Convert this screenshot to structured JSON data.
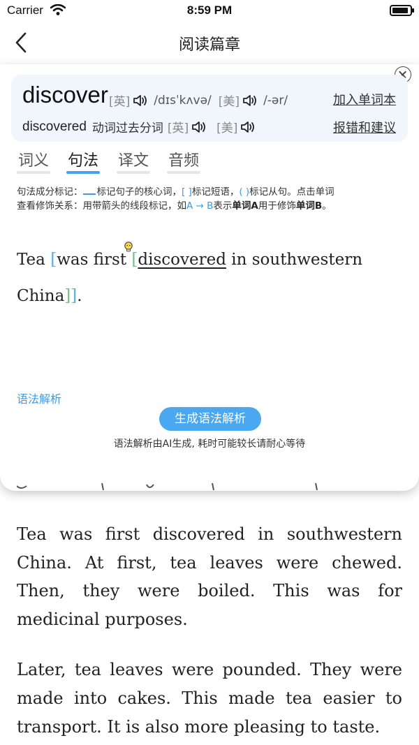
{
  "status_bar": {
    "carrier": "Carrier",
    "time": "8:59 PM",
    "battery_level": 0.9
  },
  "nav": {
    "title": "阅读篇章",
    "back_icon": "chevron-left-icon"
  },
  "popup": {
    "word": "discover",
    "uk_tag": "[英]",
    "uk_phonetic": "/dɪsˈkʌvə/",
    "us_tag": "[美]",
    "us_phonetic": "/-ər/",
    "add_vocab": "加入单词本",
    "form_word": "discovered",
    "form_desc": "动词过去分词",
    "form_uk_tag": "[英]",
    "form_us_tag": "[美]",
    "report": "报错和建议",
    "tabs": [
      {
        "label": "词义",
        "active": false
      },
      {
        "label": "句法",
        "active": true
      },
      {
        "label": "译文",
        "active": false
      },
      {
        "label": "音频",
        "active": false
      }
    ],
    "legend": {
      "part1": "句法成分标记：",
      "part2": "标记句子的核心词，",
      "bracket_sq": "[ ]",
      "part3": "标记短语，",
      "bracket_paren": "( )",
      "part4": "标记从句。点击单词",
      "part5": "查看修饰关系：用带箭头的线段标记，如",
      "example": "A → B",
      "part6": "表示",
      "word_a": "单词A",
      "part7": "用于修饰",
      "word_b": "单词B",
      "part8": "。"
    },
    "sentence": {
      "w1": "Tea",
      "open1": "[",
      "w2": "was first",
      "open2": "[",
      "core": "discovered",
      "w3": "in southwestern China",
      "close2": "]",
      "close1": "]",
      "end": "."
    },
    "grammar_label": "语法解析",
    "generate_button": "生成语法解析",
    "generate_note": "语法解析由AI生成, 耗时可能较长请耐心等待"
  },
  "article": {
    "paragraphs": [
      "Tea was first discovered in southwestern China. At first, tea leaves were chewed. Then, they were boiled. This was for medicinal purposes.",
      "Later, tea leaves were pounded. They were made into cakes. This made tea easier to transport. It is also more pleasing to taste."
    ]
  },
  "colors": {
    "accent": "#4aa8f0",
    "link_blue": "#3a9be3",
    "card_bg": "#f0f6fc",
    "bracket_green": "#6ebf8a"
  }
}
